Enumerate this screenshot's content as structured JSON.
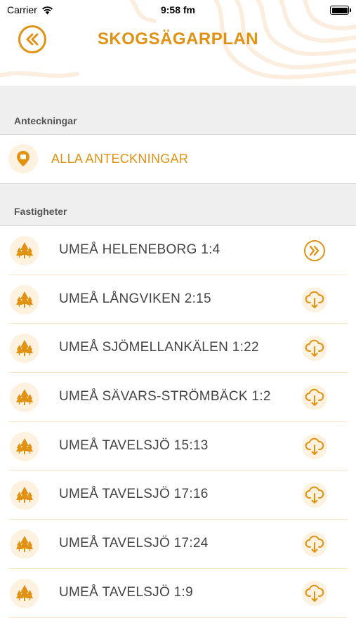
{
  "status_bar": {
    "carrier": "Carrier",
    "time": "9:58 fm",
    "wifi_icon": "wifi-icon",
    "battery_icon": "battery-icon"
  },
  "header": {
    "title": "SKOGSÄGARPLAN",
    "back_icon": "double-chevron-left-icon"
  },
  "notes_section": {
    "label": "Anteckningar",
    "all_notes": "ALLA ANTECKNINGAR",
    "icon": "map-marker-icon"
  },
  "properties_section": {
    "label": "Fastigheter",
    "items": [
      {
        "name": "UMEÅ HELENEBORG 1:4",
        "action": "open"
      },
      {
        "name": "UMEÅ LÅNGVIKEN 2:15",
        "action": "download"
      },
      {
        "name": "UMEÅ SJÖMELLANKÄLEN 1:22",
        "action": "download"
      },
      {
        "name": "UMEÅ SÄVARS-STRÖMBÄCK 1:2",
        "action": "download"
      },
      {
        "name": "UMEÅ TAVELSJÖ 15:13",
        "action": "download"
      },
      {
        "name": "UMEÅ TAVELSJÖ 17:16",
        "action": "download"
      },
      {
        "name": "UMEÅ TAVELSJÖ 17:24",
        "action": "download"
      },
      {
        "name": "UMEÅ TAVELSJÖ 1:9",
        "action": "download"
      }
    ]
  },
  "colors": {
    "accent": "#e29213",
    "accent_light": "#fdf1e0",
    "section_bg": "#efefef",
    "text": "#444444"
  }
}
